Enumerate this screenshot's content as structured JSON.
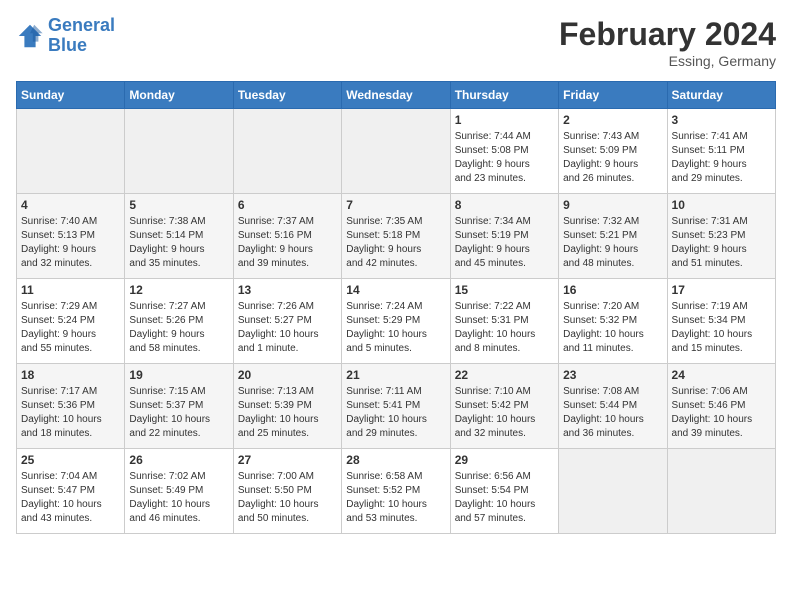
{
  "header": {
    "logo_line1": "General",
    "logo_line2": "Blue",
    "month_year": "February 2024",
    "location": "Essing, Germany"
  },
  "weekdays": [
    "Sunday",
    "Monday",
    "Tuesday",
    "Wednesday",
    "Thursday",
    "Friday",
    "Saturday"
  ],
  "weeks": [
    [
      {
        "day": "",
        "info": ""
      },
      {
        "day": "",
        "info": ""
      },
      {
        "day": "",
        "info": ""
      },
      {
        "day": "",
        "info": ""
      },
      {
        "day": "1",
        "info": "Sunrise: 7:44 AM\nSunset: 5:08 PM\nDaylight: 9 hours\nand 23 minutes."
      },
      {
        "day": "2",
        "info": "Sunrise: 7:43 AM\nSunset: 5:09 PM\nDaylight: 9 hours\nand 26 minutes."
      },
      {
        "day": "3",
        "info": "Sunrise: 7:41 AM\nSunset: 5:11 PM\nDaylight: 9 hours\nand 29 minutes."
      }
    ],
    [
      {
        "day": "4",
        "info": "Sunrise: 7:40 AM\nSunset: 5:13 PM\nDaylight: 9 hours\nand 32 minutes."
      },
      {
        "day": "5",
        "info": "Sunrise: 7:38 AM\nSunset: 5:14 PM\nDaylight: 9 hours\nand 35 minutes."
      },
      {
        "day": "6",
        "info": "Sunrise: 7:37 AM\nSunset: 5:16 PM\nDaylight: 9 hours\nand 39 minutes."
      },
      {
        "day": "7",
        "info": "Sunrise: 7:35 AM\nSunset: 5:18 PM\nDaylight: 9 hours\nand 42 minutes."
      },
      {
        "day": "8",
        "info": "Sunrise: 7:34 AM\nSunset: 5:19 PM\nDaylight: 9 hours\nand 45 minutes."
      },
      {
        "day": "9",
        "info": "Sunrise: 7:32 AM\nSunset: 5:21 PM\nDaylight: 9 hours\nand 48 minutes."
      },
      {
        "day": "10",
        "info": "Sunrise: 7:31 AM\nSunset: 5:23 PM\nDaylight: 9 hours\nand 51 minutes."
      }
    ],
    [
      {
        "day": "11",
        "info": "Sunrise: 7:29 AM\nSunset: 5:24 PM\nDaylight: 9 hours\nand 55 minutes."
      },
      {
        "day": "12",
        "info": "Sunrise: 7:27 AM\nSunset: 5:26 PM\nDaylight: 9 hours\nand 58 minutes."
      },
      {
        "day": "13",
        "info": "Sunrise: 7:26 AM\nSunset: 5:27 PM\nDaylight: 10 hours\nand 1 minute."
      },
      {
        "day": "14",
        "info": "Sunrise: 7:24 AM\nSunset: 5:29 PM\nDaylight: 10 hours\nand 5 minutes."
      },
      {
        "day": "15",
        "info": "Sunrise: 7:22 AM\nSunset: 5:31 PM\nDaylight: 10 hours\nand 8 minutes."
      },
      {
        "day": "16",
        "info": "Sunrise: 7:20 AM\nSunset: 5:32 PM\nDaylight: 10 hours\nand 11 minutes."
      },
      {
        "day": "17",
        "info": "Sunrise: 7:19 AM\nSunset: 5:34 PM\nDaylight: 10 hours\nand 15 minutes."
      }
    ],
    [
      {
        "day": "18",
        "info": "Sunrise: 7:17 AM\nSunset: 5:36 PM\nDaylight: 10 hours\nand 18 minutes."
      },
      {
        "day": "19",
        "info": "Sunrise: 7:15 AM\nSunset: 5:37 PM\nDaylight: 10 hours\nand 22 minutes."
      },
      {
        "day": "20",
        "info": "Sunrise: 7:13 AM\nSunset: 5:39 PM\nDaylight: 10 hours\nand 25 minutes."
      },
      {
        "day": "21",
        "info": "Sunrise: 7:11 AM\nSunset: 5:41 PM\nDaylight: 10 hours\nand 29 minutes."
      },
      {
        "day": "22",
        "info": "Sunrise: 7:10 AM\nSunset: 5:42 PM\nDaylight: 10 hours\nand 32 minutes."
      },
      {
        "day": "23",
        "info": "Sunrise: 7:08 AM\nSunset: 5:44 PM\nDaylight: 10 hours\nand 36 minutes."
      },
      {
        "day": "24",
        "info": "Sunrise: 7:06 AM\nSunset: 5:46 PM\nDaylight: 10 hours\nand 39 minutes."
      }
    ],
    [
      {
        "day": "25",
        "info": "Sunrise: 7:04 AM\nSunset: 5:47 PM\nDaylight: 10 hours\nand 43 minutes."
      },
      {
        "day": "26",
        "info": "Sunrise: 7:02 AM\nSunset: 5:49 PM\nDaylight: 10 hours\nand 46 minutes."
      },
      {
        "day": "27",
        "info": "Sunrise: 7:00 AM\nSunset: 5:50 PM\nDaylight: 10 hours\nand 50 minutes."
      },
      {
        "day": "28",
        "info": "Sunrise: 6:58 AM\nSunset: 5:52 PM\nDaylight: 10 hours\nand 53 minutes."
      },
      {
        "day": "29",
        "info": "Sunrise: 6:56 AM\nSunset: 5:54 PM\nDaylight: 10 hours\nand 57 minutes."
      },
      {
        "day": "",
        "info": ""
      },
      {
        "day": "",
        "info": ""
      }
    ]
  ]
}
